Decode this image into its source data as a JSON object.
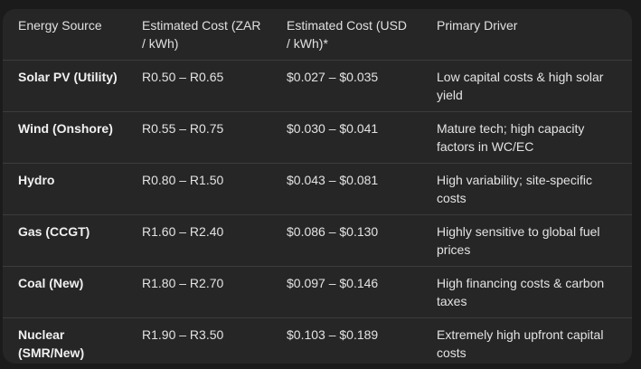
{
  "table": {
    "headers": [
      "Energy Source",
      "Estimated Cost (ZAR / kWh)",
      "Estimated Cost (USD / kWh)*",
      "Primary Driver"
    ],
    "rows": [
      {
        "source": "Solar PV (Utility)",
        "zar": "R0.50 – R0.65",
        "usd": "$0.027 – $0.035",
        "driver": "Low capital costs & high solar yield"
      },
      {
        "source": "Wind (Onshore)",
        "zar": "R0.55 – R0.75",
        "usd": "$0.030 – $0.041",
        "driver": "Mature tech; high capacity factors in WC/EC"
      },
      {
        "source": "Hydro",
        "zar": "R0.80 – R1.50",
        "usd": "$0.043 – $0.081",
        "driver": "High variability; site-specific costs"
      },
      {
        "source": "Gas (CCGT)",
        "zar": "R1.60 – R2.40",
        "usd": "$0.086 – $0.130",
        "driver": "Highly sensitive to global fuel prices"
      },
      {
        "source": "Coal (New)",
        "zar": "R1.80 – R2.70",
        "usd": "$0.097 – $0.146",
        "driver": "High financing costs & carbon taxes"
      },
      {
        "source": "Nuclear (SMR/New)",
        "zar": "R1.90 – R3.50",
        "usd": "$0.103 – $0.189",
        "driver": "Extremely high upfront capital costs"
      }
    ]
  }
}
